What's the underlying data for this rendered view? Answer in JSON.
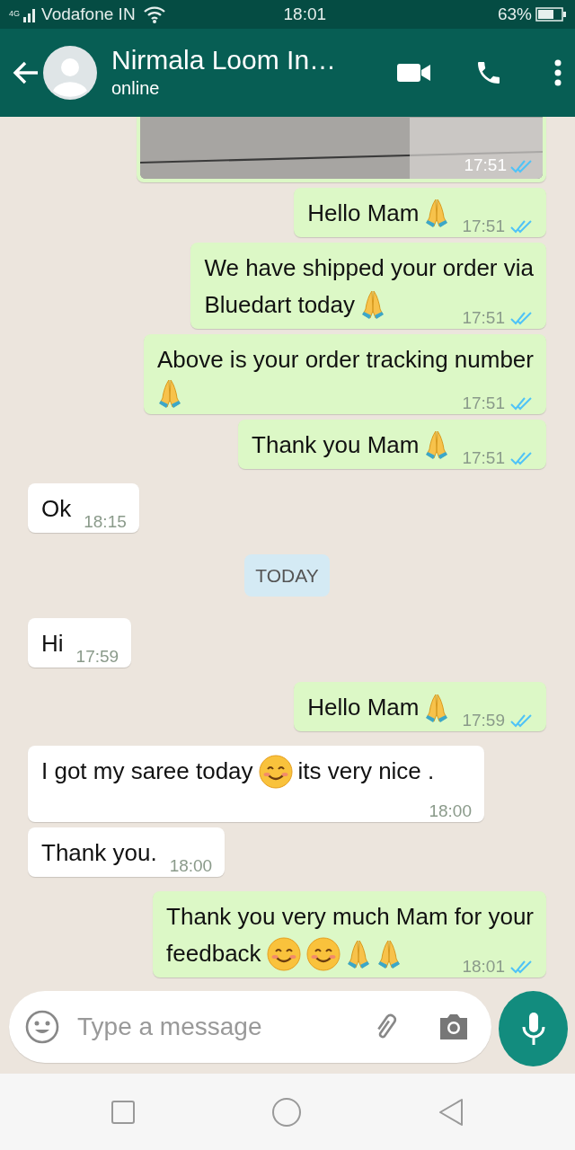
{
  "status_bar": {
    "carrier": "Vodafone IN",
    "network": "4G",
    "time": "18:01",
    "battery": "63%"
  },
  "header": {
    "title": "Nirmala Loom In…",
    "subtitle": "online"
  },
  "messages": [
    {
      "outgoing": true,
      "time": "17:51",
      "read": true
    },
    {
      "kind": "text",
      "outgoing": true,
      "time": "17:51",
      "read": true,
      "lines": [
        [
          {
            "kind": "text",
            "text": "Hello Mam"
          },
          {
            "kind": "pray"
          }
        ]
      ]
    },
    {
      "kind": "text",
      "outgoing": true,
      "time": "17:51",
      "read": true,
      "lines": [
        [
          {
            "kind": "text",
            "text": "We have shipped your order via"
          }
        ],
        [
          {
            "kind": "text",
            "text": "Bluedart today"
          },
          {
            "kind": "pray"
          }
        ]
      ]
    },
    {
      "kind": "text",
      "outgoing": true,
      "time": "17:51",
      "read": true,
      "lines": [
        [
          {
            "kind": "text",
            "text": "Above is your order tracking number"
          }
        ],
        [
          {
            "kind": "pray"
          }
        ]
      ]
    },
    {
      "kind": "text",
      "outgoing": true,
      "time": "17:51",
      "read": true,
      "lines": [
        [
          {
            "kind": "text",
            "text": "Thank you Mam"
          },
          {
            "kind": "pray"
          }
        ]
      ]
    },
    {
      "kind": "text",
      "outgoing": false,
      "time": "18:15",
      "lines": [
        [
          {
            "kind": "text",
            "text": "Ok"
          }
        ]
      ]
    },
    {
      "kind": "date",
      "text": "TODAY"
    },
    {
      "kind": "text",
      "outgoing": false,
      "time": "17:59",
      "lines": [
        [
          {
            "kind": "text",
            "text": "Hi"
          }
        ]
      ]
    },
    {
      "kind": "text",
      "outgoing": true,
      "time": "17:59",
      "read": true,
      "lines": [
        [
          {
            "kind": "text",
            "text": "Hello Mam"
          },
          {
            "kind": "pray"
          }
        ]
      ]
    },
    {
      "kind": "text",
      "outgoing": false,
      "time": "18:00",
      "lines": [
        [
          {
            "kind": "text",
            "text": "I got my saree today"
          },
          {
            "kind": "smile"
          },
          {
            "kind": "text",
            "text": "its very nice ."
          }
        ]
      ]
    },
    {
      "kind": "text",
      "outgoing": false,
      "time": "18:00",
      "lines": [
        [
          {
            "kind": "text",
            "text": "Thank you."
          }
        ]
      ]
    },
    {
      "kind": "text",
      "outgoing": true,
      "time": "18:01",
      "read": true,
      "lines": [
        [
          {
            "kind": "text",
            "text": "Thank you very much Mam for your"
          }
        ],
        [
          {
            "kind": "text",
            "text": "feedback"
          },
          {
            "kind": "smile"
          },
          {
            "kind": "smile"
          },
          {
            "kind": "pray"
          },
          {
            "kind": "pray"
          }
        ]
      ]
    }
  ],
  "composer": {
    "placeholder": "Type a message"
  }
}
